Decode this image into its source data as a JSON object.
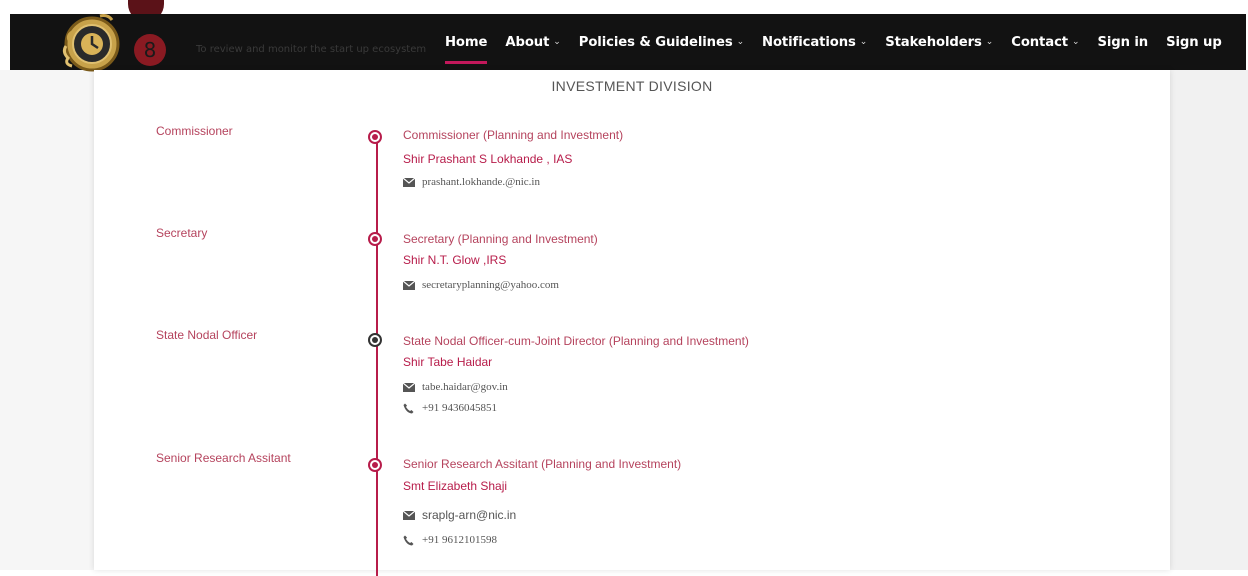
{
  "header": {
    "nav": [
      {
        "label": "Home",
        "has_dropdown": false,
        "active": true
      },
      {
        "label": "About",
        "has_dropdown": true
      },
      {
        "label": "Policies & Guidelines",
        "has_dropdown": true
      },
      {
        "label": "Notifications",
        "has_dropdown": true
      },
      {
        "label": "Stakeholders",
        "has_dropdown": true
      },
      {
        "label": "Contact",
        "has_dropdown": true
      },
      {
        "label": "Sign in",
        "has_dropdown": false
      },
      {
        "label": "Sign up",
        "has_dropdown": false
      }
    ],
    "accent_color": "#c2185b",
    "background_color": "#121212"
  },
  "background_text": {
    "step_number": "8",
    "faded_line": "To review and monitor the start up ecosystem"
  },
  "main": {
    "section_title": "INVESTMENT DIVISION",
    "entries": [
      {
        "label": "Commissioner",
        "role": "Commissioner (Planning and Investment)",
        "name": "Shir Prashant S Lokhande , IAS",
        "email": "prashant.lokhande.@nic.in",
        "phone": null
      },
      {
        "label": "Secretary",
        "role": "Secretary (Planning and Investment)",
        "name": "Shir N.T. Glow ,IRS",
        "email": "secretaryplanning@yahoo.com",
        "phone": null
      },
      {
        "label": "State Nodal Officer",
        "role": "State Nodal Officer-cum-Joint Director (Planning and Investment)",
        "name": "Shir Tabe Haidar",
        "email": "tabe.haidar@gov.in",
        "phone": "+91 9436045851"
      },
      {
        "label": "Senior Research Assitant",
        "role": "Senior Research Assitant (Planning and Investment)",
        "name": "Smt Elizabeth Shaji",
        "email": "sraplg-arn@nic.in",
        "phone": "+91 9612101598"
      }
    ],
    "timeline_color": "#b71c4a",
    "icons": {
      "email": "envelope-icon",
      "phone": "phone-icon",
      "dot": "timeline-dot-icon"
    }
  }
}
